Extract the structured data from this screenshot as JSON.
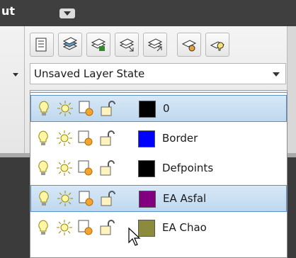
{
  "topbar": {
    "tab_label": "ut"
  },
  "layer_state": {
    "value": "Unsaved Layer State"
  },
  "current_layer": {
    "name": "0",
    "color": "#000000"
  },
  "layers": [
    {
      "name": "0",
      "color": "#000000",
      "selected": true
    },
    {
      "name": "Border",
      "color": "#0000ff",
      "selected": false
    },
    {
      "name": "Defpoints",
      "color": "#000000",
      "selected": false
    },
    {
      "name": "EA Asfal",
      "color": "#800080",
      "selected": true
    },
    {
      "name": "EA Chao",
      "color": "#8c8a3c",
      "selected": false
    }
  ],
  "icon_names": [
    "lightbulb-icon",
    "sun-icon",
    "freeze-viewport-icon",
    "unlock-icon",
    "color-swatch"
  ]
}
